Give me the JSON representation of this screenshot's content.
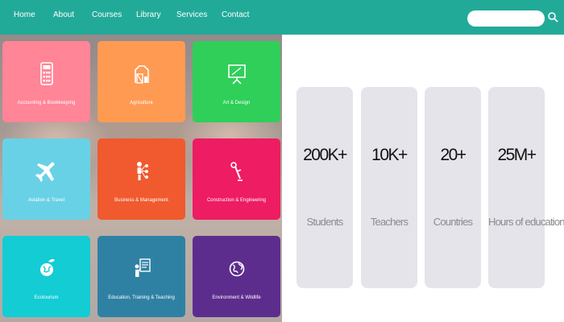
{
  "nav": {
    "links": [
      "Home",
      "About",
      "Courses",
      "Library",
      "Services",
      "Contact"
    ],
    "search": {
      "placeholder": "",
      "icon": "search-icon"
    },
    "background": "#22aa98"
  },
  "categories": [
    {
      "label": "Accounting & Bookkeeping",
      "icon": "calculator-icon",
      "color": "#ff8597"
    },
    {
      "label": "Agriculture",
      "icon": "barn-icon",
      "color": "#ff9a53"
    },
    {
      "label": "Art & Design",
      "icon": "easel-icon",
      "color": "#2fcf59"
    },
    {
      "label": "Aviation & Travel",
      "icon": "airplane-icon",
      "color": "#69d1e6"
    },
    {
      "label": "Business & Management",
      "icon": "org-chart-icon",
      "color": "#f05a2e"
    },
    {
      "label": "Construction & Engineering",
      "icon": "crane-icon",
      "color": "#ee1c62"
    },
    {
      "label": "Ecotourism",
      "icon": "globe-leaf-icon",
      "color": "#13ccd4"
    },
    {
      "label": "Education, Training & Teaching",
      "icon": "teaching-board-icon",
      "color": "#2f81a4"
    },
    {
      "label": "Environment & Wildlife",
      "icon": "earth-icon",
      "color": "#5d2d8e"
    }
  ],
  "stats": [
    {
      "value": "200K+",
      "label": "Students"
    },
    {
      "value": "10K+",
      "label": "Teachers"
    },
    {
      "value": "20+",
      "label": "Countries"
    },
    {
      "value": "25M+",
      "label": "Hours of education"
    }
  ]
}
